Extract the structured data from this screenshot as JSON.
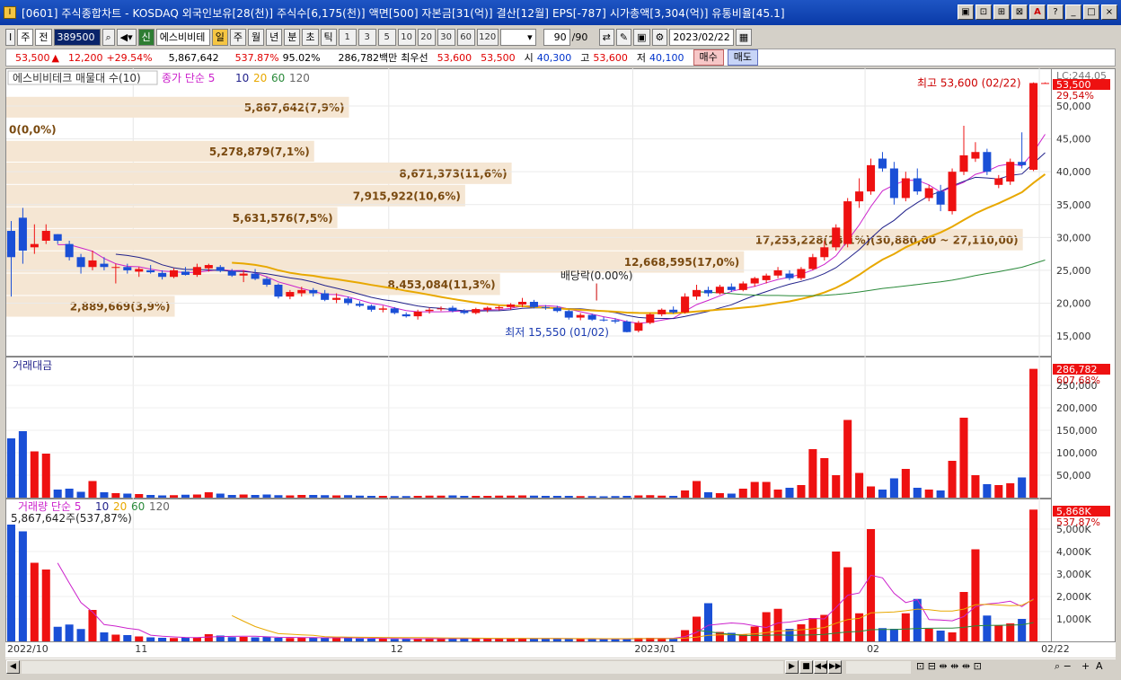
{
  "window": {
    "title": "[0601] 주식종합차트 - KOSDAQ 외국인보유[28(천)] 주식수[6,175(천)] 액면[500] 자본금[31(억)] 결산[12월] EPS[-787] 시가총액[3,304(억)] 유통비율[45.1]",
    "app_icon": "I",
    "buttons": [
      "▣",
      "⊡",
      "⊞",
      "⊠",
      "A",
      "?",
      "_",
      "□",
      "×"
    ]
  },
  "toolbar": {
    "code_icon": "I",
    "period": "주",
    "prev": "전",
    "stock_code": "389500",
    "stock_name": "에스비비테",
    "credit_badge": "신",
    "day": "일",
    "week": "주",
    "month": "월",
    "year": "년",
    "minute": "분",
    "second": "초",
    "tick": "틱",
    "intervals": [
      "1",
      "3",
      "5",
      "10",
      "20",
      "30",
      "60",
      "120"
    ],
    "count": "90",
    "count_total": "/90",
    "date": "2023/02/22"
  },
  "quote": {
    "price": "53,500",
    "arrow": "▲",
    "change": "12,200",
    "change_pct": "+29.54%",
    "volume": "5,867,642",
    "volume_pct": "537.87%",
    "ratio": "95.02%",
    "amount": "286,782백만",
    "best_label": "최우선",
    "ask": "53,600",
    "bid": "53,500",
    "open_label": "시",
    "open": "40,300",
    "high_label": "고",
    "high": "53,600",
    "low_label": "저",
    "low": "40,100",
    "buy": "매수",
    "sell": "매도"
  },
  "panels": {
    "main_title": "에스비비테크 매물대 수(10)",
    "main_ma": "종가 단순 5",
    "amount_title": "거래대금",
    "volume_title": "거래량 단순 5",
    "volume_value": "5,867,642주(537,87%)",
    "ma_periods": [
      "10",
      "20",
      "60",
      "120"
    ]
  },
  "colors": {
    "up": "#ee1111",
    "down": "#1a4fd6",
    "ma5": "#cc22cc",
    "ma10": "#22228b",
    "ma20": "#e8a800",
    "ma60": "#2a8a3a",
    "volume_profile": "#f5e6d3",
    "profile_text": "#7a4a10"
  },
  "chart_data": {
    "type": "candlestick",
    "price_axis": {
      "ticks": [
        "50,000",
        "45,000",
        "40,000",
        "35,000",
        "30,000",
        "25,000",
        "20,000",
        "15,000"
      ],
      "tick_values": [
        50000,
        45000,
        40000,
        35000,
        30000,
        25000,
        20000,
        15000
      ],
      "range": [
        12000,
        55200
      ],
      "lc_label": "LC:244,05",
      "current_badge": "53,500",
      "current_pct": "29,54%"
    },
    "amount_axis": {
      "ticks": [
        "250,000",
        "200,000",
        "150,000",
        "100,000",
        "50,000"
      ],
      "tick_values": [
        250000,
        200000,
        150000,
        100000,
        50000
      ],
      "range": [
        0,
        300000
      ],
      "current_badge": "286,782",
      "current_pct": "607,68%"
    },
    "volume_axis": {
      "ticks": [
        "5,000K",
        "4,000K",
        "3,000K",
        "2,000K",
        "1,000K"
      ],
      "tick_values": [
        5000,
        4000,
        3000,
        2000,
        1000
      ],
      "range": [
        0,
        6000
      ],
      "current_badge": "5,868K",
      "current_pct": "537,87%"
    },
    "x_labels": [
      {
        "label": "2022/10",
        "index": 0
      },
      {
        "label": "11",
        "index": 11
      },
      {
        "label": "12",
        "index": 33
      },
      {
        "label": "2023/01",
        "index": 54
      },
      {
        "label": "02",
        "index": 74
      },
      {
        "label": "02/22",
        "index": 89
      }
    ],
    "annotations": {
      "high": "최고 53,600 (02/22)",
      "low": "최저 15,550 (01/02)",
      "dividend": "배당락(0.00%)"
    },
    "volume_profile": [
      {
        "label": "5,867,642(7,9%)",
        "price_lo": 48100,
        "price_hi": 51400,
        "end_index": 29
      },
      {
        "label": "0(0,0%)",
        "price_lo": 44700,
        "price_hi": 48100,
        "end_index": 0
      },
      {
        "label": "5,278,879(7,1%)",
        "price_lo": 41400,
        "price_hi": 44700,
        "end_index": 26
      },
      {
        "label": "8,671,373(11,6%)",
        "price_lo": 38000,
        "price_hi": 41400,
        "end_index": 43
      },
      {
        "label": "7,915,922(10,6%)",
        "price_lo": 34600,
        "price_hi": 38000,
        "end_index": 39
      },
      {
        "label": "5,631,576(7,5%)",
        "price_lo": 31300,
        "price_hi": 34600,
        "end_index": 28
      },
      {
        "label": "17,253,228(23,1%)(30,880,00 ~ 27,110,00)",
        "price_lo": 27900,
        "price_hi": 31300,
        "end_index": 87
      },
      {
        "label": "12,668,595(17,0%)",
        "price_lo": 24500,
        "price_hi": 27900,
        "end_index": 63
      },
      {
        "label": "8,453,084(11,3%)",
        "price_lo": 21100,
        "price_hi": 24500,
        "end_index": 42
      },
      {
        "label": "2,889,669(3,9%)",
        "price_lo": 17800,
        "price_hi": 21100,
        "end_index": 14
      }
    ],
    "candles": [
      [
        31000,
        32500,
        21000,
        27000
      ],
      [
        33000,
        34500,
        26000,
        28000
      ],
      [
        28500,
        32000,
        27500,
        29000
      ],
      [
        29500,
        32000,
        29000,
        31000
      ],
      [
        30500,
        30500,
        29000,
        29500
      ],
      [
        29000,
        29500,
        26500,
        27000
      ],
      [
        27000,
        27500,
        24500,
        25500
      ],
      [
        25500,
        28000,
        25000,
        26500
      ],
      [
        26000,
        27000,
        25000,
        25500
      ],
      [
        25500,
        26000,
        23000,
        25500
      ],
      [
        25500,
        26000,
        24500,
        25000
      ],
      [
        24800,
        25500,
        24000,
        25200
      ],
      [
        25000,
        25800,
        24500,
        24700
      ],
      [
        24600,
        25000,
        23600,
        24000
      ],
      [
        24000,
        25300,
        23800,
        25000
      ],
      [
        24800,
        25500,
        24200,
        24300
      ],
      [
        24300,
        26000,
        24000,
        25500
      ],
      [
        25300,
        26000,
        24800,
        25800
      ],
      [
        25500,
        25800,
        24700,
        24900
      ],
      [
        24900,
        25200,
        24000,
        24200
      ],
      [
        24200,
        25000,
        23200,
        24500
      ],
      [
        24500,
        25200,
        23500,
        23700
      ],
      [
        23700,
        24000,
        22500,
        22800
      ],
      [
        22800,
        23000,
        20700,
        21000
      ],
      [
        21000,
        22000,
        20600,
        21700
      ],
      [
        21500,
        22500,
        21000,
        22000
      ],
      [
        22000,
        22300,
        21000,
        21500
      ],
      [
        21500,
        22000,
        20300,
        20500
      ],
      [
        20500,
        21500,
        20000,
        20800
      ],
      [
        20700,
        21000,
        19700,
        20000
      ],
      [
        19900,
        20300,
        19400,
        19600
      ],
      [
        19600,
        19800,
        18700,
        19000
      ],
      [
        19000,
        19600,
        18600,
        19200
      ],
      [
        19200,
        19400,
        18300,
        18500
      ],
      [
        18300,
        18600,
        17800,
        18000
      ],
      [
        18000,
        19000,
        17500,
        18700
      ],
      [
        18800,
        19300,
        18400,
        19000
      ],
      [
        19100,
        19500,
        18800,
        19200
      ],
      [
        19300,
        19600,
        18600,
        18800
      ],
      [
        18800,
        19100,
        18300,
        18500
      ],
      [
        18500,
        19300,
        18300,
        19100
      ],
      [
        19000,
        19500,
        18600,
        19300
      ],
      [
        19200,
        19600,
        18900,
        19400
      ],
      [
        19400,
        20000,
        19000,
        19800
      ],
      [
        19800,
        20800,
        19400,
        20200
      ],
      [
        20200,
        20500,
        19200,
        19400
      ],
      [
        19400,
        19700,
        19000,
        19300
      ],
      [
        19300,
        19600,
        18600,
        18800
      ],
      [
        18800,
        19000,
        17500,
        17800
      ],
      [
        17800,
        18500,
        17400,
        18200
      ],
      [
        18200,
        18400,
        17300,
        17500
      ],
      [
        17500,
        17900,
        17200,
        17400
      ],
      [
        17400,
        17700,
        16900,
        17200
      ],
      [
        17200,
        17400,
        15550,
        15600
      ],
      [
        15800,
        17300,
        15550,
        17000
      ],
      [
        17000,
        18500,
        16800,
        18300
      ],
      [
        18300,
        19200,
        18000,
        19000
      ],
      [
        19000,
        19500,
        18400,
        18600
      ],
      [
        18600,
        21500,
        18400,
        21000
      ],
      [
        21000,
        22800,
        20500,
        22000
      ],
      [
        22000,
        22500,
        21000,
        21500
      ],
      [
        21500,
        22800,
        21300,
        22500
      ],
      [
        22500,
        23000,
        21700,
        22000
      ],
      [
        22000,
        23300,
        21800,
        23000
      ],
      [
        23000,
        24000,
        22500,
        23800
      ],
      [
        23500,
        24500,
        23000,
        24200
      ],
      [
        24200,
        25500,
        23800,
        25000
      ],
      [
        24500,
        25000,
        23500,
        23800
      ],
      [
        23800,
        25500,
        23500,
        25200
      ],
      [
        25200,
        27500,
        25000,
        27000
      ],
      [
        27000,
        29500,
        26500,
        28500
      ],
      [
        28500,
        32000,
        28000,
        31500
      ],
      [
        29000,
        36000,
        28500,
        35500
      ],
      [
        35500,
        39000,
        34500,
        37000
      ],
      [
        37000,
        42000,
        36500,
        41000
      ],
      [
        42000,
        43000,
        40000,
        40500
      ],
      [
        40500,
        41500,
        35000,
        36000
      ],
      [
        36000,
        40000,
        35500,
        39000
      ],
      [
        39000,
        40500,
        36500,
        37000
      ],
      [
        36000,
        38000,
        35500,
        37500
      ],
      [
        37000,
        38000,
        34000,
        35000
      ],
      [
        34000,
        40500,
        33500,
        40000
      ],
      [
        40000,
        47000,
        39500,
        42500
      ],
      [
        42000,
        44500,
        41500,
        43000
      ],
      [
        43000,
        43500,
        39500,
        40000
      ],
      [
        38000,
        39500,
        37500,
        39000
      ],
      [
        38500,
        42000,
        38000,
        41500
      ],
      [
        41500,
        46000,
        40500,
        41000
      ],
      [
        40300,
        53600,
        40100,
        53500
      ],
      [
        53500,
        53600,
        53500,
        53500
      ]
    ],
    "amount": [
      132000,
      148000,
      103000,
      98000,
      18000,
      20000,
      13000,
      37000,
      12000,
      10000,
      9000,
      8000,
      6000,
      5000,
      5500,
      6500,
      7000,
      12000,
      9000,
      6000,
      7000,
      6000,
      7000,
      5500,
      5000,
      6000,
      6000,
      5500,
      5000,
      5500,
      4500,
      4000,
      4000,
      3500,
      3500,
      4000,
      4500,
      4500,
      5000,
      4000,
      4000,
      4000,
      4500,
      4500,
      5000,
      4500,
      4000,
      4000,
      4000,
      3500,
      3500,
      3000,
      3500,
      4000,
      5000,
      5500,
      4500,
      4000,
      16000,
      37000,
      12000,
      10000,
      9000,
      20000,
      35000,
      35000,
      18000,
      22000,
      28000,
      108000,
      88000,
      50000,
      173000,
      55000,
      25000,
      18000,
      43000,
      64000,
      22000,
      18000,
      16000,
      82000,
      178000,
      50000,
      30000,
      28000,
      32000,
      45000,
      286782
    ],
    "volume": [
      5200,
      4900,
      3500,
      3200,
      650,
      750,
      550,
      1400,
      400,
      300,
      280,
      220,
      180,
      160,
      150,
      170,
      180,
      320,
      260,
      190,
      200,
      180,
      200,
      160,
      150,
      170,
      170,
      160,
      150,
      160,
      130,
      120,
      120,
      110,
      110,
      120,
      130,
      130,
      140,
      120,
      120,
      120,
      130,
      130,
      140,
      130,
      120,
      120,
      120,
      110,
      110,
      100,
      110,
      120,
      150,
      160,
      140,
      130,
      500,
      1100,
      1700,
      420,
      380,
      320,
      660,
      1300,
      1450,
      560,
      760,
      1040,
      1180,
      4000,
      3300,
      1250,
      5000,
      590,
      560,
      1250,
      1890,
      560,
      480,
      400,
      2200,
      4100,
      1150,
      700,
      800,
      1000,
      5868
    ]
  }
}
